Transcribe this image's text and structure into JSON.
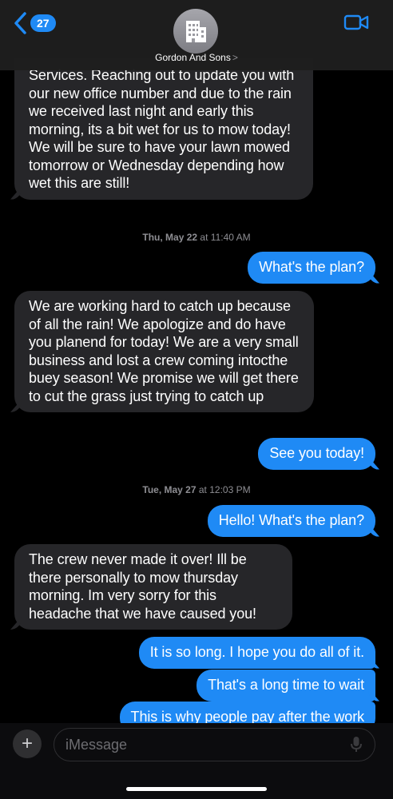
{
  "header": {
    "back_count": "27",
    "contact_name": "Gordon And Sons",
    "contact_chevron": ">"
  },
  "messages": [
    {
      "dir": "in",
      "text": "Services. Reaching out to update you with our new office number and due to the rain we received last night and early this morning, its a bit wet for us to mow today! We will be sure to have your lawn mowed tomorrow or Wednesday depending how wet this are still!"
    },
    {
      "dir": "time",
      "day": "Thu, May 22",
      "at": "at",
      "time": "11:40 AM"
    },
    {
      "dir": "out",
      "text": "What's the plan?"
    },
    {
      "dir": "in",
      "text": "We are working hard to catch up because of all the rain! We apologize and do have you planend for today! We are a very small business and lost a crew coming intocthe buey season! We promise we will get there to cut the grass just trying to catch up"
    },
    {
      "dir": "out",
      "text": "See you today!"
    },
    {
      "dir": "time",
      "day": "Tue, May 27",
      "at": "at",
      "time": "12:03 PM"
    },
    {
      "dir": "out",
      "text": "Hello! What's the plan?"
    },
    {
      "dir": "in",
      "text": "The crew never made it over! Ill be there personally to mow thursday morning. Im very sorry for this headache that we have caused you!"
    },
    {
      "dir": "out",
      "text": "It is so long. I hope you do all of it."
    },
    {
      "dir": "out",
      "text": "That's a long time to wait"
    },
    {
      "dir": "out",
      "text": "This is why people pay after the work"
    }
  ],
  "composer": {
    "placeholder": "iMessage",
    "plus_symbol": "+"
  },
  "icons": {
    "back": "chevron-left-icon",
    "avatar": "building-icon",
    "video": "video-camera-icon",
    "mic": "microphone-icon"
  },
  "colors": {
    "accent": "#1f8af5",
    "incoming_bubble": "#262629",
    "background": "#000000",
    "secondary_text": "#8e8e93"
  }
}
